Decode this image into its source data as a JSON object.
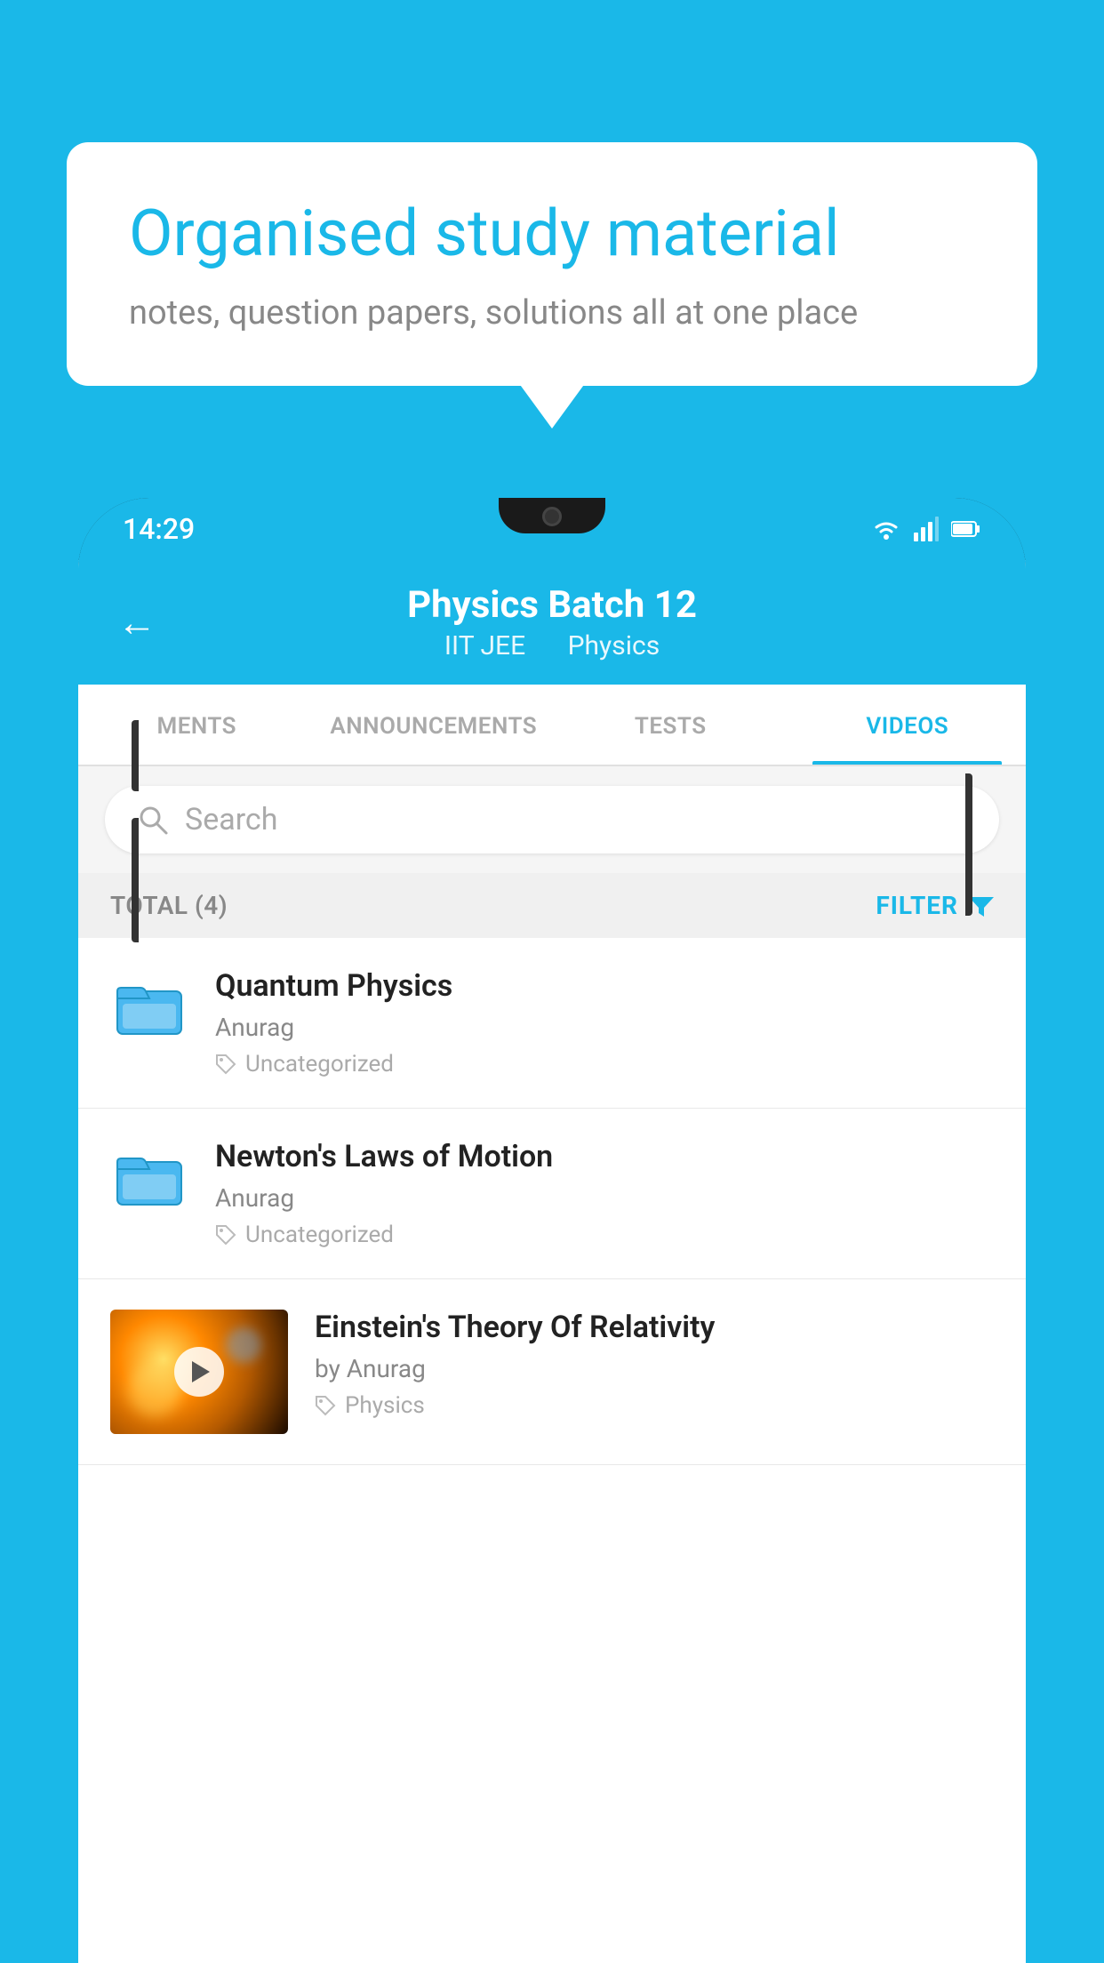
{
  "background_color": "#1ab8e8",
  "speech_bubble": {
    "title": "Organised study material",
    "subtitle": "notes, question papers, solutions all at one place"
  },
  "status_bar": {
    "time": "14:29",
    "icons": [
      "wifi",
      "signal",
      "battery"
    ]
  },
  "header": {
    "back_label": "←",
    "title": "Physics Batch 12",
    "subtitle_part1": "IIT JEE",
    "subtitle_part2": "Physics"
  },
  "tabs": [
    {
      "label": "MENTS",
      "active": false
    },
    {
      "label": "ANNOUNCEMENTS",
      "active": false
    },
    {
      "label": "TESTS",
      "active": false
    },
    {
      "label": "VIDEOS",
      "active": true
    }
  ],
  "search": {
    "placeholder": "Search"
  },
  "filter_bar": {
    "total_label": "TOTAL (4)",
    "filter_label": "FILTER"
  },
  "video_items": [
    {
      "title": "Quantum Physics",
      "author": "Anurag",
      "tag": "Uncategorized",
      "type": "folder"
    },
    {
      "title": "Newton's Laws of Motion",
      "author": "Anurag",
      "tag": "Uncategorized",
      "type": "folder"
    },
    {
      "title": "Einstein's Theory Of Relativity",
      "author": "by Anurag",
      "tag": "Physics",
      "type": "video"
    }
  ]
}
